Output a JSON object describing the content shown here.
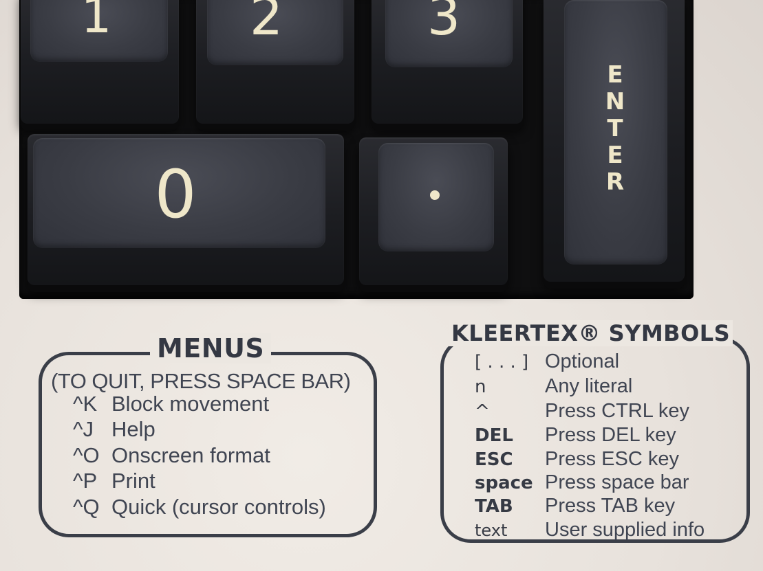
{
  "keys": {
    "one": "1",
    "two": "2",
    "three": "3",
    "zero": "0",
    "enter": [
      "E",
      "N",
      "T",
      "E",
      "R"
    ]
  },
  "menus": {
    "title": "MENUS",
    "subtitle": "(TO QUIT, PRESS SPACE BAR)",
    "items": [
      {
        "key": "^K",
        "label": "Block movement"
      },
      {
        "key": "^J",
        "label": "Help"
      },
      {
        "key": "^O",
        "label": "Onscreen format"
      },
      {
        "key": "^P",
        "label": "Print"
      },
      {
        "key": "^Q",
        "label": "Quick (cursor controls)"
      }
    ]
  },
  "symbols": {
    "title": "KLEERTEX® SYMBOLS",
    "items": [
      {
        "symbol": "[ . . . ]",
        "meaning": "Optional"
      },
      {
        "symbol": "n",
        "meaning": "Any literal"
      },
      {
        "symbol": "^",
        "meaning": "Press CTRL key"
      },
      {
        "symbol": "DEL",
        "meaning": "Press DEL key"
      },
      {
        "symbol": "ESC",
        "meaning": "Press ESC key"
      },
      {
        "symbol": "space",
        "meaning": "Press space bar"
      },
      {
        "symbol": "TAB",
        "meaning": "Press TAB key"
      },
      {
        "symbol": "text",
        "meaning": "User supplied info"
      }
    ]
  }
}
